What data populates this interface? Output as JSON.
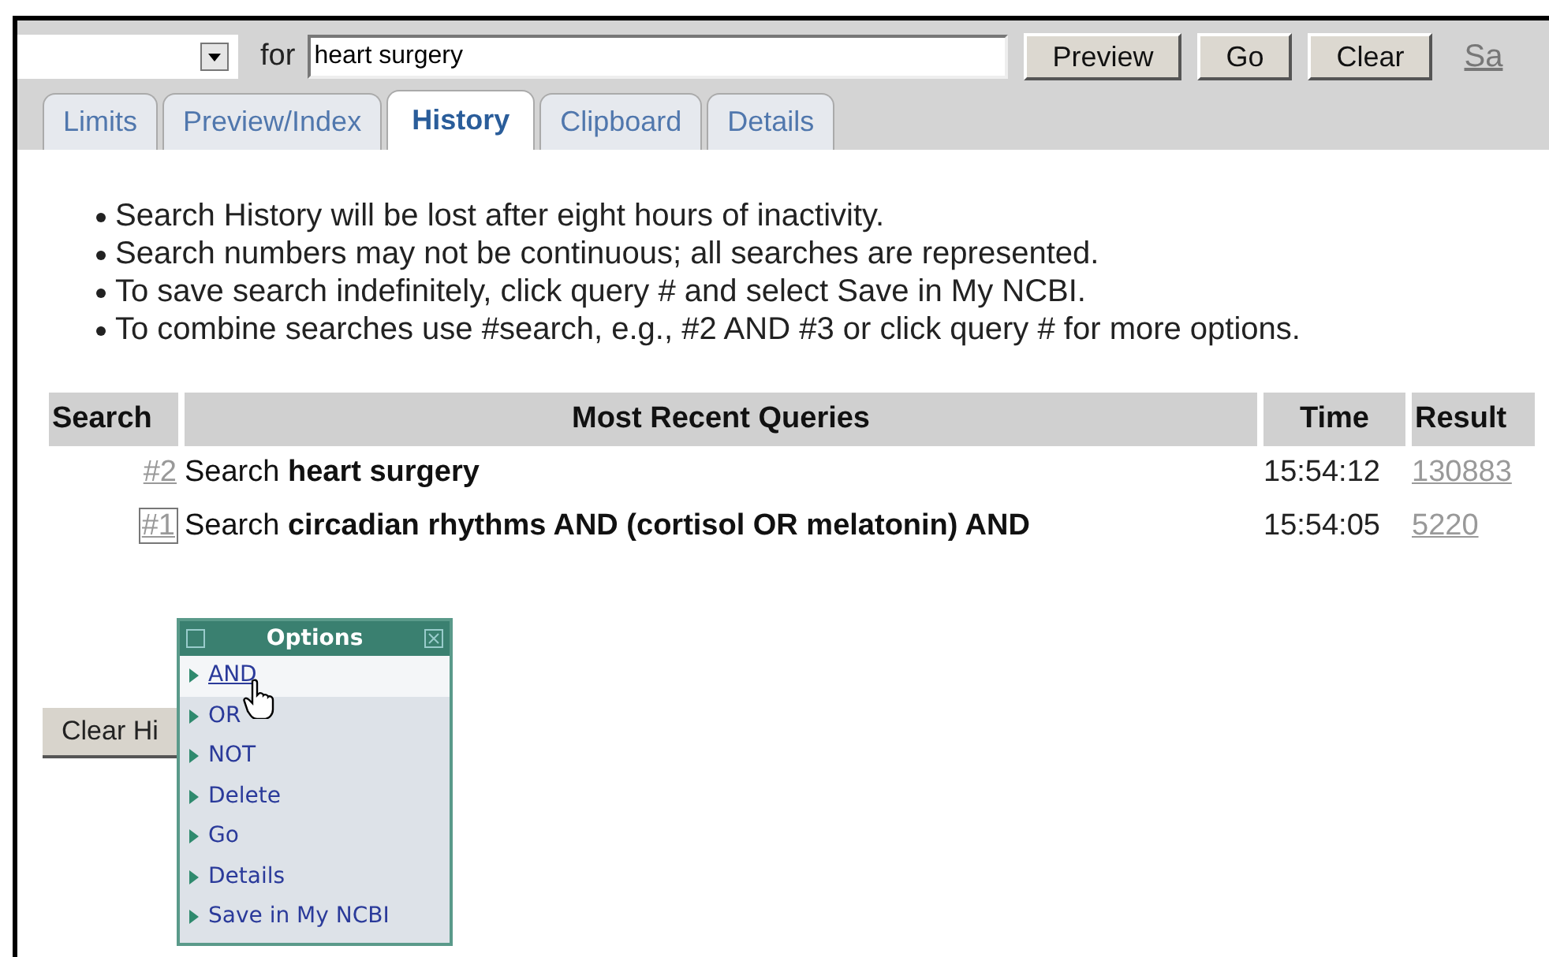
{
  "search_bar": {
    "label": "for",
    "value": "heart surgery",
    "buttons": [
      "Preview",
      "Go",
      "Clear"
    ],
    "cut_link": "Sa"
  },
  "tabs": [
    {
      "label": "Limits",
      "selected": false
    },
    {
      "label": "Preview/Index",
      "selected": false
    },
    {
      "label": "History",
      "selected": true
    },
    {
      "label": "Clipboard",
      "selected": false
    },
    {
      "label": "Details",
      "selected": false
    }
  ],
  "notes": [
    "Search History will be lost after eight hours of inactivity.",
    "Search numbers may not be continuous; all searches are represented.",
    "To save search indefinitely, click query # and select Save in My NCBI.",
    "To combine searches use #search, e.g., #2 AND #3 or click query # for more options."
  ],
  "table": {
    "columns": [
      "Search",
      "Most Recent Queries",
      "Time",
      "Result"
    ],
    "rows": [
      {
        "number": "#2",
        "query": "Search **heart surgery**",
        "time": "15:54:12",
        "result": "130883",
        "selected": false
      },
      {
        "number": "#1",
        "query": "Search **circadian rhythms AND (cortisol OR melatonin) AND**",
        "time": "15:54:05",
        "result": "5220",
        "selected": true
      }
    ]
  },
  "clear_button": "Clear Hi",
  "options_menu": {
    "title": "Options",
    "items": [
      {
        "label": "AND",
        "selected": true
      },
      {
        "label": "OR",
        "selected": false
      },
      {
        "label": "NOT",
        "selected": false
      },
      {
        "label": "Delete",
        "selected": false
      },
      {
        "label": "Go",
        "selected": false
      },
      {
        "label": "Details",
        "selected": false
      },
      {
        "label": "Save in My NCBI",
        "selected": false
      }
    ]
  }
}
